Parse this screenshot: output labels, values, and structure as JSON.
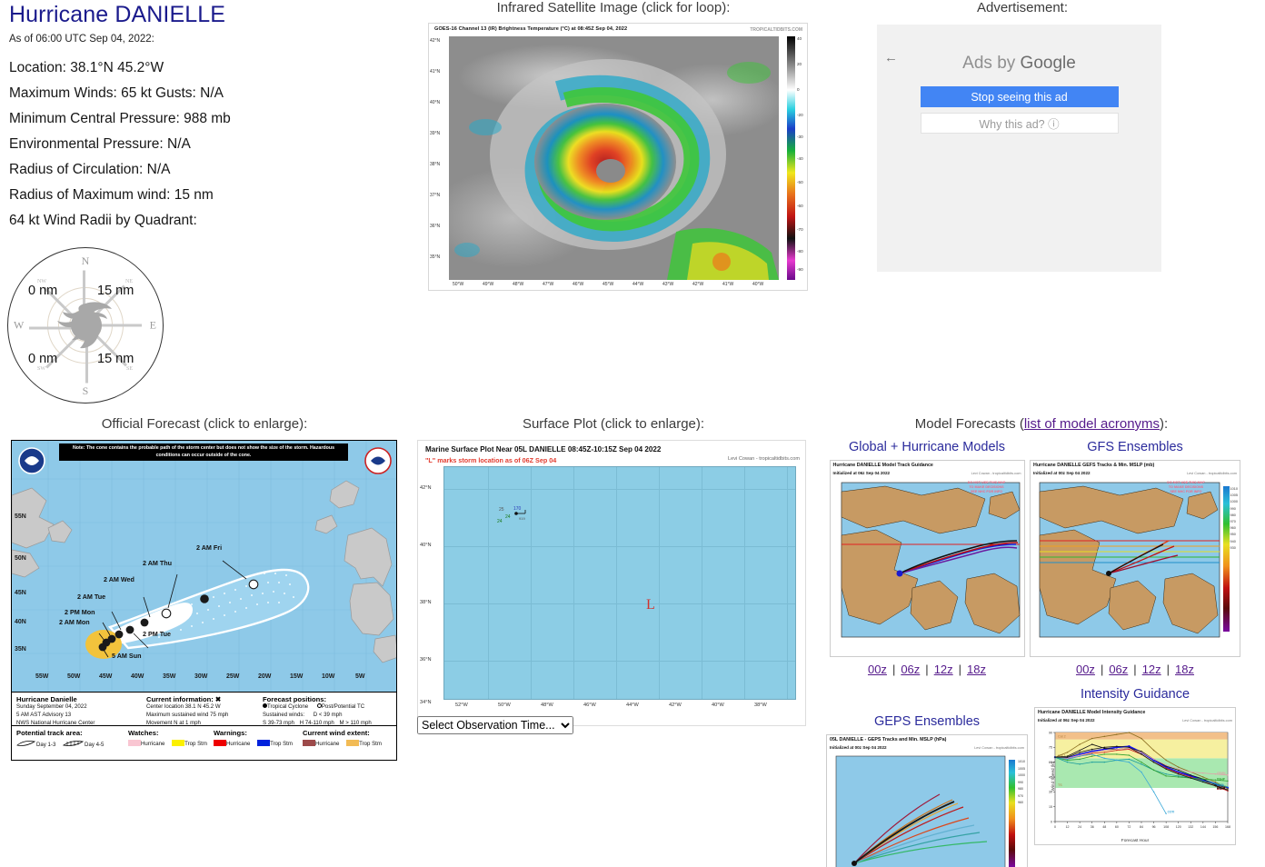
{
  "storm": {
    "title": "Hurricane DANIELLE",
    "as_of": "As of 06:00 UTC Sep 04, 2022:",
    "stats": [
      "Location: 38.1°N 45.2°W",
      "Maximum Winds: 65 kt  Gusts: N/A",
      "Minimum Central Pressure: 988 mb",
      "Environmental Pressure: N/A",
      "Radius of Circulation: N/A",
      "Radius of Maximum wind: 15 nm",
      "64 kt Wind Radii by Quadrant:"
    ],
    "wind_radii": {
      "nw": "0 nm",
      "ne": "15 nm",
      "sw": "0 nm",
      "se": "15 nm",
      "directions": {
        "n": "N",
        "s": "S",
        "e": "E",
        "w": "W"
      },
      "diagonals": {
        "nw": "NW",
        "ne": "NE",
        "sw": "SW",
        "se": "SE"
      }
    }
  },
  "satellite": {
    "heading": "Infrared Satellite Image (click for loop):",
    "caption": "GOES-16 Channel 13 (IR) Brightness Temperature (°C) at 08:45Z Sep 04, 2022",
    "credit": "TROPICALTIDBITS.COM",
    "lat_ticks": [
      "42°N",
      "41°N",
      "40°N",
      "39°N",
      "38°N",
      "37°N",
      "36°N",
      "35°N"
    ],
    "lon_ticks": [
      "50°W",
      "49°W",
      "48°W",
      "47°W",
      "46°W",
      "45°W",
      "44°W",
      "43°W",
      "42°W",
      "41°W",
      "40°W"
    ],
    "colorbar_ticks": [
      "40",
      "20",
      "0",
      "-20",
      "-30",
      "-40",
      "-50",
      "-60",
      "-70",
      "-80",
      "-90"
    ]
  },
  "advertisement": {
    "heading": "Advertisement:",
    "back_arrow": "←",
    "ads_by": "Ads by ",
    "ads_by_brand": "Google",
    "stop_label": "Stop seeing this ad",
    "why_label": "Why this ad? ⓘ"
  },
  "official_forecast": {
    "heading": "Official Forecast (click to enlarge):",
    "note": "Note: The cone contains the probable path of the storm center but does not show the size of the storm. Hazardous conditions can occur outside of the cone.",
    "lat_ticks": [
      "55N",
      "50N",
      "45N",
      "40N",
      "35N"
    ],
    "lon_ticks": [
      "55W",
      "50W",
      "45W",
      "40W",
      "35W",
      "30W",
      "25W",
      "20W",
      "15W",
      "10W",
      "5W"
    ],
    "track_labels": [
      "5 AM Sun",
      "2 AM Mon",
      "2 PM Mon",
      "2 AM Tue",
      "2 PM Tue",
      "2 AM Wed",
      "2 AM Thu",
      "2 AM Fri"
    ],
    "legend": {
      "storm_name": "Hurricane Danielle",
      "date": "Sunday September 04, 2022",
      "advisory": "5 AM AST Advisory 13",
      "agency": "NWS National Hurricane Center",
      "current_head": "Current information: ✖",
      "current_center": "Center location 38.1 N 45.2 W",
      "current_wind": "Maximum sustained wind 75 mph",
      "current_motion": "Movement N at 1 mph",
      "positions_head": "Forecast positions:",
      "pos_tc": "Tropical Cyclone",
      "pos_post": "Post/Potential TC",
      "wind_head": "Sustained winds:",
      "wind_d": "D < 39 mph",
      "wind_s": "S 39-73 mph",
      "wind_h": "H 74-110 mph",
      "wind_m": "M > 110 mph",
      "track_head": "Potential track area:",
      "track_day13": "Day 1-3",
      "track_day45": "Day 4-5",
      "watches_head": "Watches:",
      "warnings_head": "Warnings:",
      "extent_head": "Current wind extent:",
      "hurricane": "Hurricane",
      "tropstm": "Trop Stm"
    }
  },
  "surface_plot": {
    "heading": "Surface Plot (click to enlarge):",
    "title": "Marine Surface Plot Near 05L DANIELLE 08:45Z-10:15Z Sep 04 2022",
    "subtitle": "\"L\" marks storm location as of 06Z Sep 04",
    "credit": "Levi Cowan - tropicaltidbits.com",
    "low_marker": "L",
    "lat_ticks": [
      "42°N",
      "40°N",
      "38°N",
      "36°N",
      "34°N"
    ],
    "lon_ticks": [
      "52°W",
      "50°W",
      "48°W",
      "46°W",
      "44°W",
      "42°W",
      "40°W",
      "38°W"
    ],
    "observation": {
      "temp": "25",
      "dewpoint": "24",
      "pressure": "170",
      "sub": "919"
    },
    "select_label": "Select Observation Time..."
  },
  "models": {
    "heading_pre": "Model Forecasts (",
    "heading_link": "list of model acronyms",
    "heading_post": "):",
    "hour_links": [
      "00z",
      "06z",
      "12z",
      "18z"
    ],
    "warn_text": "DO NOT USE THIS MAP\nTO MAKE DECISIONS\nSEE NHC FOR INFO",
    "credit": "Levi Cowan - tropicaltidbits.com",
    "panels": [
      {
        "name": "Global + Hurricane Models",
        "chart_title": "Hurricane DANIELLE Model Track Guidance",
        "chart_sub": "Initialized at 06z Sep 04 2022"
      },
      {
        "name": "GFS Ensembles",
        "chart_title": "Hurricane DANIELLE GEFS Tracks & Min. MSLP (mb)",
        "chart_sub": "Initialized at 00z Sep 04 2022",
        "colorbar_ticks": [
          "1010",
          "1005",
          "1000",
          "990",
          "980",
          "970",
          "960",
          "950",
          "940",
          "930"
        ]
      },
      {
        "name": "GEPS Ensembles",
        "chart_title": "05L DANIELLE - GEPS Tracks and Min. MSLP (hPa)",
        "chart_sub": "Initialized at 00z Sep 04 2022",
        "colorbar_ticks": [
          "1010",
          "1005",
          "1000",
          "990",
          "980",
          "970",
          "960"
        ]
      },
      {
        "name": "Intensity Guidance",
        "chart_title": "Hurricane DANIELLE Model Intensity Guidance",
        "chart_sub": "Initialized at 06z Sep 04 2022"
      }
    ]
  },
  "chart_data": {
    "type": "line",
    "title": "Hurricane DANIELLE Model Intensity Guidance",
    "subtitle": "Initialized at 06z Sep 04 2022",
    "xlabel": "Forecast Hour",
    "ylabel": "Wind Speed (kt)",
    "xlim": [
      0,
      168
    ],
    "ylim": [
      0,
      90
    ],
    "xticks": [
      0,
      12,
      24,
      36,
      48,
      60,
      72,
      84,
      96,
      108,
      120,
      132,
      144,
      156,
      168
    ],
    "yticks": [
      0,
      15,
      30,
      45,
      60,
      75,
      90
    ],
    "grid": false,
    "legend": "inline-labels",
    "bands": [
      {
        "label": "TS",
        "from": 34,
        "to": 64,
        "color": "#a9e8b0"
      },
      {
        "label": "Cat 1",
        "from": 64,
        "to": 83,
        "color": "#f6f0a0"
      },
      {
        "label": "Cat 2",
        "from": 83,
        "to": 96,
        "color": "#f2c08a"
      }
    ],
    "series": [
      {
        "name": "OFCL",
        "color": "#1111ee",
        "x": [
          0,
          12,
          24,
          36,
          48,
          60,
          72,
          84,
          96,
          108,
          120,
          132,
          144,
          156,
          168
        ],
        "values": [
          65,
          64,
          68,
          71,
          73,
          75,
          76,
          70,
          62,
          55,
          50,
          46,
          42,
          38,
          34
        ]
      },
      {
        "name": "HWRF",
        "color": "#111111",
        "x": [
          0,
          12,
          24,
          36,
          48,
          60,
          72,
          84,
          96,
          108,
          120,
          132,
          144,
          156,
          168
        ],
        "values": [
          65,
          66,
          72,
          78,
          74,
          73,
          74,
          71,
          63,
          56,
          52,
          47,
          43,
          37,
          31
        ]
      },
      {
        "name": "HMON",
        "color": "#8a6d1f",
        "x": [
          0,
          12,
          24,
          36,
          48,
          60,
          72,
          84,
          96,
          108,
          120,
          132,
          144,
          156,
          168
        ],
        "values": [
          65,
          70,
          78,
          84,
          86,
          88,
          90,
          84,
          72,
          62,
          55,
          50,
          45,
          40,
          33
        ]
      },
      {
        "name": "AVNO",
        "color": "#cc2222",
        "x": [
          0,
          12,
          24,
          36,
          48,
          60,
          72,
          84,
          96,
          108,
          120,
          132,
          144,
          156,
          168
        ],
        "values": [
          65,
          63,
          66,
          69,
          70,
          72,
          73,
          68,
          60,
          54,
          49,
          45,
          41,
          36,
          31
        ]
      },
      {
        "name": "CTCI",
        "color": "#1a9c9c",
        "x": [
          0,
          12,
          24,
          36,
          48,
          60,
          72,
          84,
          96,
          108,
          120,
          132,
          144,
          156,
          168
        ],
        "values": [
          65,
          60,
          58,
          60,
          60,
          62,
          63,
          58,
          52,
          48,
          46,
          44,
          41,
          38,
          35
        ]
      },
      {
        "name": "CEMN",
        "color": "#e0a0a8",
        "x": [
          0,
          12,
          24,
          36,
          48,
          60,
          72,
          84,
          96,
          108,
          120,
          132,
          144,
          156,
          168
        ],
        "values": [
          65,
          64,
          67,
          70,
          72,
          73,
          74,
          70,
          63,
          57,
          53,
          50,
          49,
          48,
          47
        ]
      },
      {
        "name": "DSHP",
        "color": "#2fa02f",
        "x": [
          0,
          12,
          24,
          36,
          48,
          60,
          72,
          84,
          96,
          108,
          120,
          132,
          144,
          156,
          168
        ],
        "values": [
          65,
          62,
          63,
          66,
          68,
          68,
          67,
          60,
          52,
          46,
          45,
          44,
          43,
          42,
          41
        ]
      },
      {
        "name": "COTI",
        "color": "#3aa8d8",
        "x": [
          0,
          12,
          24,
          36,
          48,
          60,
          72,
          84,
          96,
          108
        ],
        "values": [
          65,
          63,
          66,
          68,
          64,
          62,
          60,
          50,
          30,
          8
        ]
      },
      {
        "name": "LGEM",
        "color": "#111111",
        "x": [
          0,
          12,
          24,
          36,
          48,
          60,
          72,
          84,
          96,
          108,
          120,
          132,
          144,
          156,
          168
        ],
        "values": [
          65,
          65,
          70,
          73,
          75,
          76,
          75,
          68,
          60,
          53,
          48,
          44,
          40,
          36,
          32
        ]
      }
    ]
  }
}
